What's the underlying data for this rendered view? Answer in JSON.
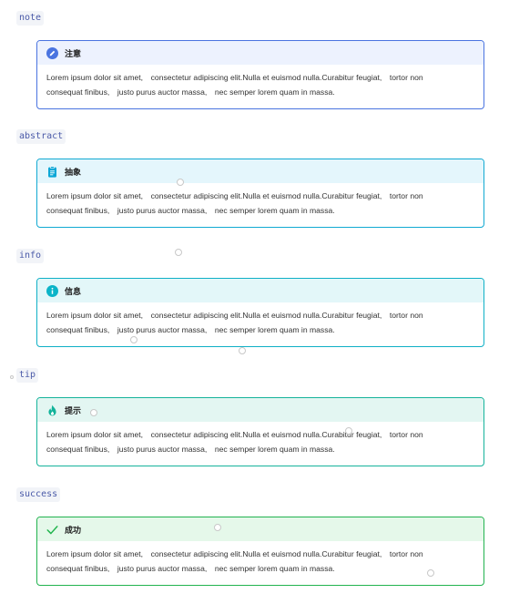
{
  "sections": [
    {
      "tag": "note",
      "title": "注意",
      "icon": "pencil-circle-icon",
      "accent": "#4a74e0",
      "head_bg": "#edf2fe",
      "border": "#4a74e0"
    },
    {
      "tag": "abstract",
      "title": "抽象",
      "icon": "clipboard-icon",
      "accent": "#0aa6d6",
      "head_bg": "#e4f6fc",
      "border": "#11a9d2"
    },
    {
      "tag": "info",
      "title": "信息",
      "icon": "info-circle-icon",
      "accent": "#0bb4c8",
      "head_bg": "#e3f7f9",
      "border": "#0fb0c6"
    },
    {
      "tag": "tip",
      "title": "提示",
      "icon": "flame-icon",
      "accent": "#12b39a",
      "head_bg": "#e3f6f2",
      "border": "#15b39b"
    },
    {
      "tag": "success",
      "title": "成功",
      "icon": "check-icon",
      "accent": "#1fb44c",
      "head_bg": "#e5f8ea",
      "border": "#22b34f"
    }
  ],
  "body_line1": "Lorem ipsum dolor sit amet,　consectetur adipiscing elit.Nulla et euismod nulla.Curabitur feugiat,　tortor non",
  "body_line2": "consequat finibus,　justo purus auctor massa,　nec semper lorem quam in massa."
}
